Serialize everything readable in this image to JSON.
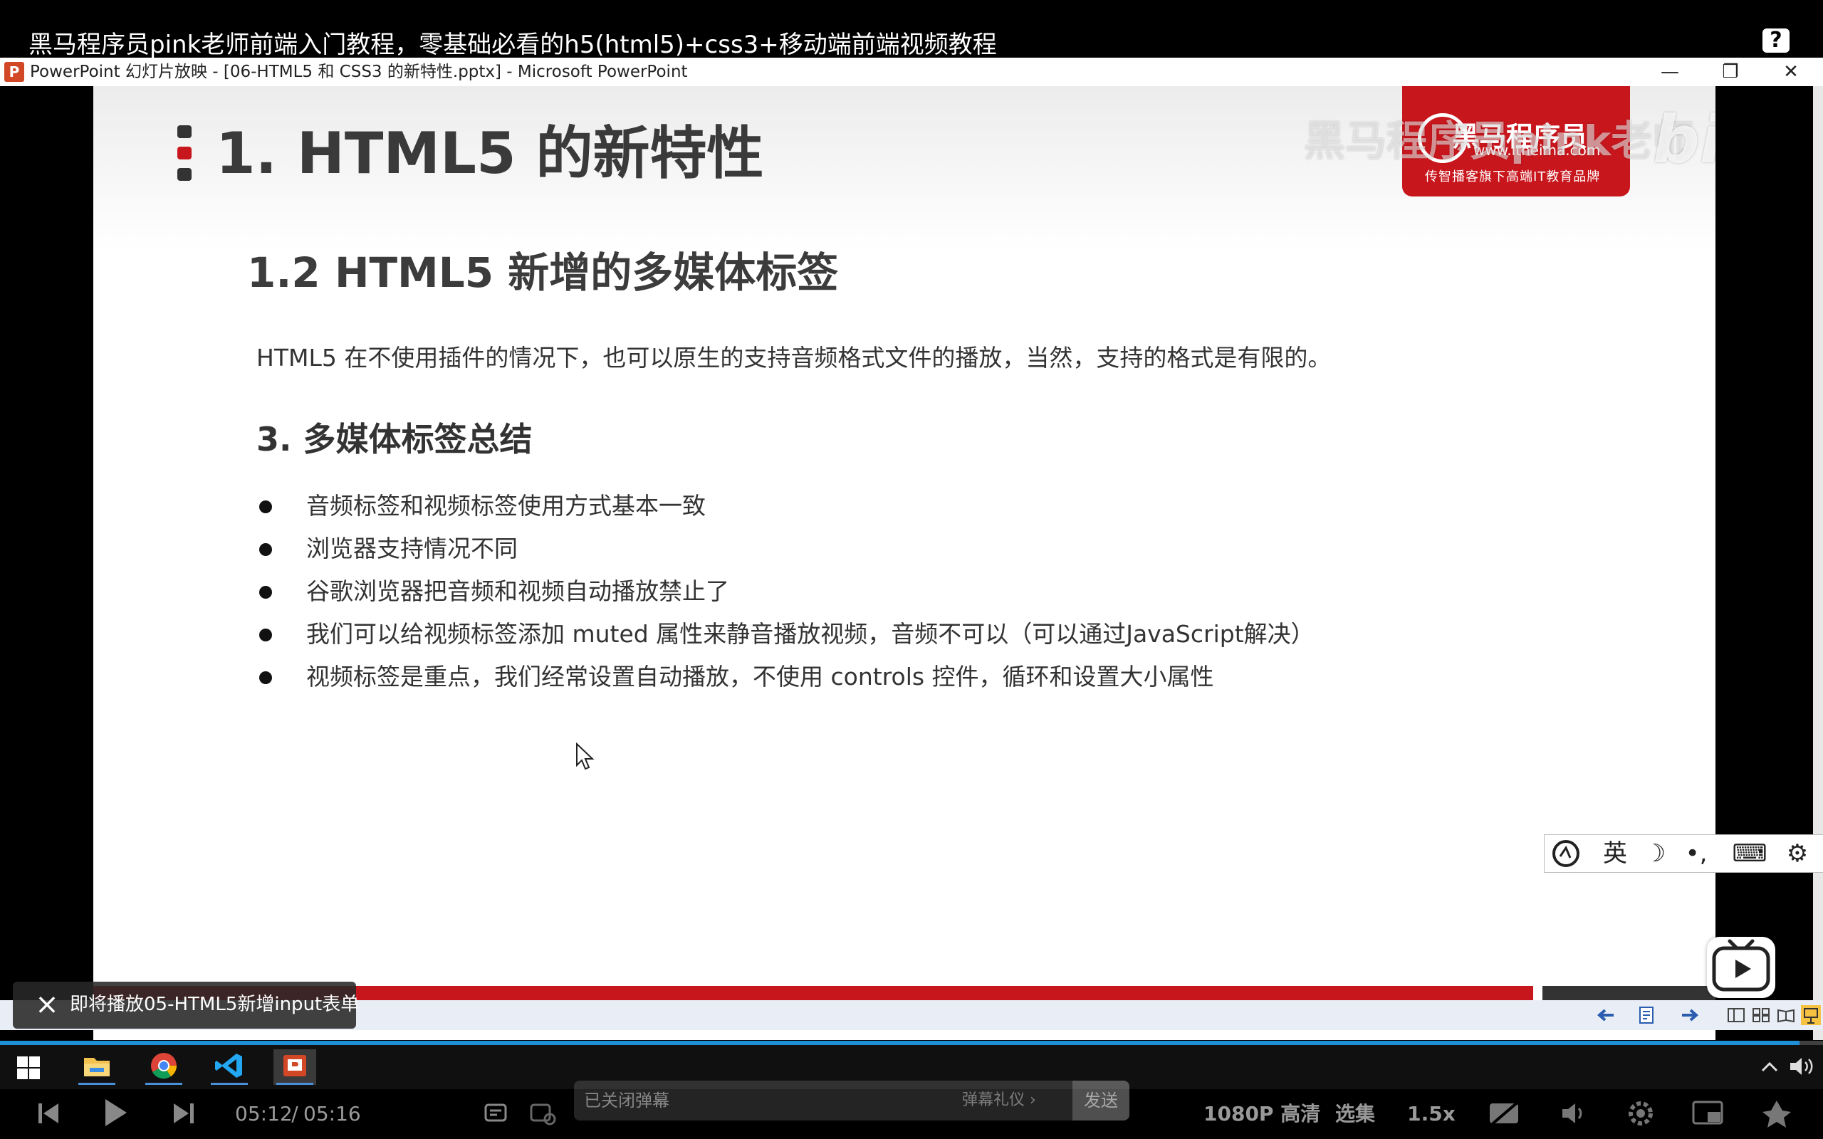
{
  "video": {
    "title": "黑马程序员pink老师前端入门教程，零基础必看的h5(html5)+css3+移动端前端视频教程",
    "help_label": "?"
  },
  "ppt": {
    "icon_letter": "P",
    "window_title": "PowerPoint 幻灯片放映 - [06-HTML5 和 CSS3 的新特性.pptx] - Microsoft PowerPoint",
    "minimize_glyph": "—",
    "restore_glyph": "❐",
    "close_glyph": "✕"
  },
  "slide": {
    "heading": "1. HTML5 的新特性",
    "subheading": "1.2 HTML5 新增的多媒体标签",
    "intro": "HTML5 在不使用插件的情况下，也可以原生的支持音频格式文件的播放，当然，支持的格式是有限的。",
    "section_title": "3. 多媒体标签总结",
    "bullets": [
      "音频标签和视频标签使用方式基本一致",
      "浏览器支持情况不同",
      "谷歌浏览器把音频和视频自动播放禁止了",
      "我们可以给视频标签添加 muted 属性来静音播放视频，音频不可以（可以通过JavaScript解决）",
      "视频标签是重点，我们经常设置自动播放，不使用 controls 控件，循环和设置大小属性"
    ],
    "logo": {
      "name": "黑马程序员",
      "url": "www.itheima.com",
      "tagline": "传智播客旗下高端IT教育品牌"
    },
    "watermark_text": "黑马程序员pink老师",
    "watermark_brand": "bilibili"
  },
  "ime": {
    "mode_label": "英",
    "moon_glyph": "☽",
    "punct_glyph": "•,",
    "keyboard_glyph": "⌨",
    "gear_glyph": "⚙"
  },
  "upnext": {
    "text": "即将播放05-HTML5新增input表单"
  },
  "player": {
    "progress": 0.987,
    "current_time": "05:12",
    "separator": "/",
    "duration": "05:16",
    "danmaku_placeholder": "已关闭弹幕",
    "danmaku_etiquette": "弹幕礼仪 ›",
    "send_label": "发送",
    "quality_label": "1080P 高清",
    "episodes_label": "选集",
    "speed_label": "1.5x"
  },
  "colors": {
    "brand_red": "#c8161d",
    "progress_blue": "#1e8fd6"
  }
}
